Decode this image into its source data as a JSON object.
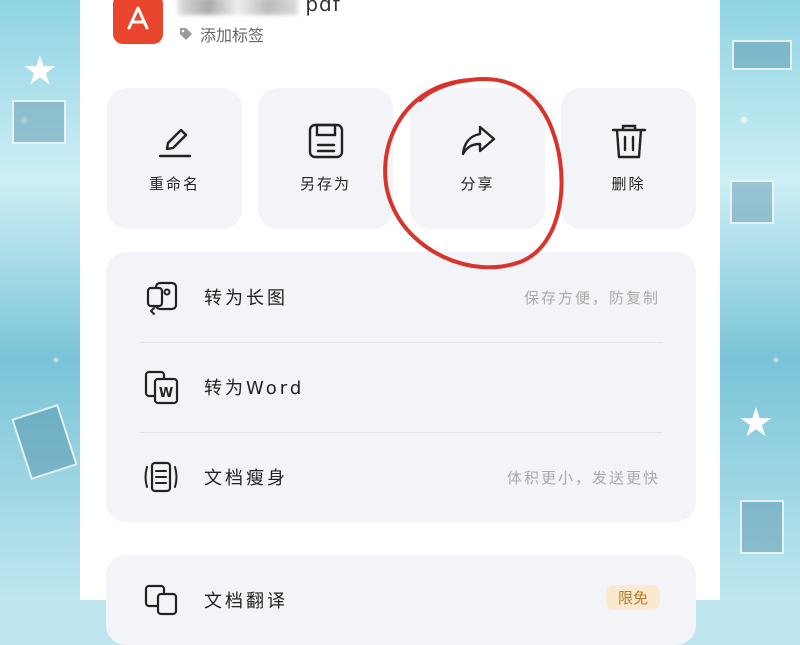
{
  "file": {
    "name_suffix": "pdf",
    "tag_label": "添加标签"
  },
  "actions": [
    {
      "label": "重命名",
      "icon": "pencil-icon"
    },
    {
      "label": "另存为",
      "icon": "save-icon"
    },
    {
      "label": "分享",
      "icon": "share-icon"
    },
    {
      "label": "删除",
      "icon": "trash-icon"
    }
  ],
  "tools": [
    {
      "label": "转为长图",
      "hint": "保存方便，防复制",
      "icon": "long-image-icon"
    },
    {
      "label": "转为Word",
      "hint": "",
      "icon": "word-icon"
    },
    {
      "label": "文档瘦身",
      "hint": "体积更小，发送更快",
      "icon": "compress-icon"
    }
  ],
  "extra": {
    "label": "文档翻译",
    "badge": "限免",
    "icon": "translate-icon"
  },
  "colors": {
    "brand": "#e8452c",
    "card_bg": "#f3f4f8",
    "annotation": "#d9342b"
  }
}
